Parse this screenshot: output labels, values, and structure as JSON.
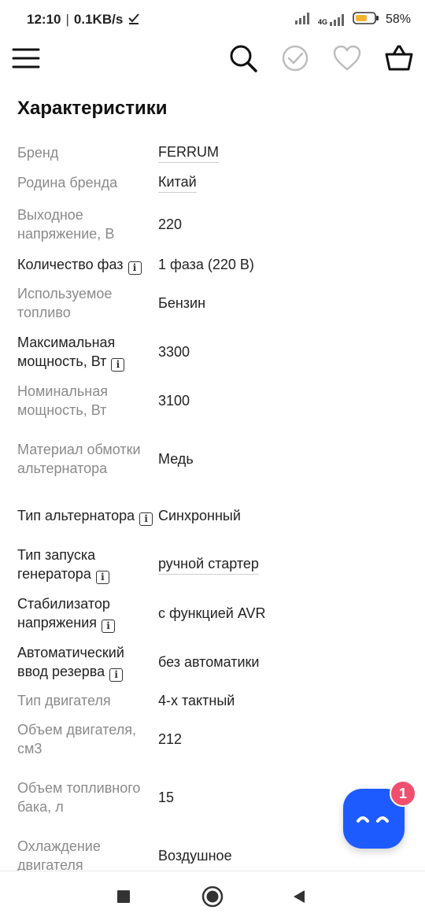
{
  "status_bar": {
    "time": "12:10",
    "speed": "0.1KB/s",
    "network": "4G",
    "battery": "58%"
  },
  "header": {
    "icons": [
      "menu-icon",
      "search-icon",
      "check-circle-icon",
      "heart-icon",
      "basket-icon"
    ]
  },
  "section_title": "Характеристики",
  "specs": [
    {
      "label": "Бренд",
      "value": "FERRUM",
      "link": true,
      "info": false,
      "dark": false
    },
    {
      "label": "Родина бренда",
      "value": "Китай",
      "link": true,
      "info": false,
      "dark": false
    },
    {
      "label": "Выходное напряжение, В",
      "value": "220",
      "link": false,
      "info": false,
      "dark": false
    },
    {
      "label": "Количество фаз",
      "value": "1 фаза (220 В)",
      "link": false,
      "info": true,
      "dark": true
    },
    {
      "label": "Используемое топливо",
      "value": "Бензин",
      "link": false,
      "info": false,
      "dark": false
    },
    {
      "label": "Максимальная мощность, Вт",
      "value": "3300",
      "link": false,
      "info": true,
      "dark": true
    },
    {
      "label": "Номинальная мощность, Вт",
      "value": "3100",
      "link": false,
      "info": false,
      "dark": false
    },
    {
      "label": "Материал обмотки альтернатора",
      "value": "Медь",
      "link": false,
      "info": false,
      "dark": false
    },
    {
      "label": "Тип альтернатора",
      "value": "Синхронный",
      "link": false,
      "info": true,
      "dark": true
    },
    {
      "label": "Тип запуска генератора",
      "value": "ручной стартер",
      "link": true,
      "info": true,
      "dark": true
    },
    {
      "label": "Стабилизатор напряжения",
      "value": "с функцией AVR",
      "link": false,
      "info": true,
      "dark": true
    },
    {
      "label": "Автоматический ввод резерва",
      "value": "без автоматики",
      "link": false,
      "info": true,
      "dark": true
    },
    {
      "label": "Тип двигателя",
      "value": "4-х тактный",
      "link": false,
      "info": false,
      "dark": false
    },
    {
      "label": "Объем двигателя, см3",
      "value": "212",
      "link": false,
      "info": false,
      "dark": false
    },
    {
      "label": "Объем топливного бака, л",
      "value": "15",
      "link": false,
      "info": false,
      "dark": false
    },
    {
      "label": "Охлаждение двигателя",
      "value": "Воздушное",
      "link": false,
      "info": false,
      "dark": false
    }
  ],
  "chat": {
    "badge_count": "1",
    "color": "#1e5bff",
    "badge_color": "#f0506e"
  },
  "nav": {
    "icons": [
      "recent-apps-icon",
      "home-icon",
      "back-icon"
    ]
  }
}
